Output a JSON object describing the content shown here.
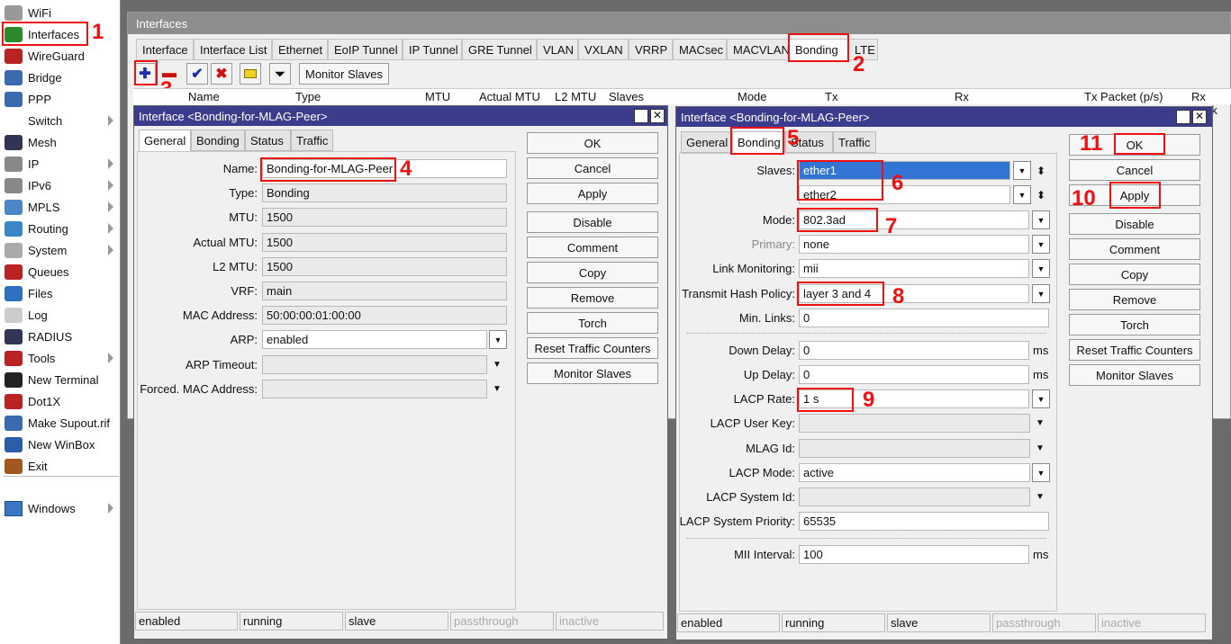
{
  "sidebar": {
    "items": [
      {
        "label": "WiFi",
        "icon": "wifi-icon"
      },
      {
        "label": "Interfaces",
        "icon": "interfaces-icon"
      },
      {
        "label": "WireGuard",
        "icon": "wireguard-icon"
      },
      {
        "label": "Bridge",
        "icon": "bridge-icon"
      },
      {
        "label": "PPP",
        "icon": "ppp-icon"
      },
      {
        "label": "Switch",
        "icon": "switch-icon"
      },
      {
        "label": "Mesh",
        "icon": "mesh-icon"
      },
      {
        "label": "IP",
        "icon": "ip-icon"
      },
      {
        "label": "IPv6",
        "icon": "ipv6-icon"
      },
      {
        "label": "MPLS",
        "icon": "mpls-icon"
      },
      {
        "label": "Routing",
        "icon": "routing-icon"
      },
      {
        "label": "System",
        "icon": "system-icon"
      },
      {
        "label": "Queues",
        "icon": "queues-icon"
      },
      {
        "label": "Files",
        "icon": "files-icon"
      },
      {
        "label": "Log",
        "icon": "log-icon"
      },
      {
        "label": "RADIUS",
        "icon": "radius-icon"
      },
      {
        "label": "Tools",
        "icon": "tools-icon"
      },
      {
        "label": "New Terminal",
        "icon": "terminal-icon"
      },
      {
        "label": "Dot1X",
        "icon": "dot1x-icon"
      },
      {
        "label": "Make Supout.rif",
        "icon": "supout-icon"
      },
      {
        "label": "New WinBox",
        "icon": "winbox-icon"
      },
      {
        "label": "Exit",
        "icon": "exit-icon"
      }
    ],
    "windows_label": "Windows"
  },
  "interfaces_window": {
    "title": "Interfaces",
    "tabs": [
      "Interface",
      "Interface List",
      "Ethernet",
      "EoIP Tunnel",
      "IP Tunnel",
      "GRE Tunnel",
      "VLAN",
      "VXLAN",
      "VRRP",
      "MACsec",
      "MACVLAN",
      "Bonding",
      "LTE"
    ],
    "monitor_slaves_label": "Monitor Slaves",
    "columns": [
      "Name",
      "Type",
      "MTU",
      "Actual MTU",
      "L2 MTU",
      "Slaves",
      "Mode",
      "Tx",
      "Rx",
      "Tx Packet (p/s)",
      "Rx Pack"
    ]
  },
  "dialog_left": {
    "title": "Interface <Bonding-for-MLAG-Peer>",
    "tabs": [
      "General",
      "Bonding",
      "Status",
      "Traffic"
    ],
    "fields": [
      {
        "label": "Name:",
        "value": "Bonding-for-MLAG-Peer"
      },
      {
        "label": "Type:",
        "value": "Bonding"
      },
      {
        "label": "MTU:",
        "value": "1500"
      },
      {
        "label": "Actual MTU:",
        "value": "1500"
      },
      {
        "label": "L2 MTU:",
        "value": "1500"
      },
      {
        "label": "VRF:",
        "value": "main"
      },
      {
        "label": "MAC Address:",
        "value": "50:00:00:01:00:00"
      },
      {
        "label": "ARP:",
        "value": "enabled"
      },
      {
        "label": "ARP Timeout:",
        "value": ""
      },
      {
        "label": "Forced. MAC Address:",
        "value": ""
      }
    ],
    "buttons": [
      "OK",
      "Cancel",
      "Apply",
      "Disable",
      "Comment",
      "Copy",
      "Remove",
      "Torch",
      "Reset Traffic Counters",
      "Monitor Slaves"
    ],
    "status": [
      "enabled",
      "running",
      "slave",
      "passthrough",
      "inactive"
    ]
  },
  "dialog_right": {
    "title": "Interface <Bonding-for-MLAG-Peer>",
    "tabs": [
      "General",
      "Bonding",
      "Status",
      "Traffic"
    ],
    "fields": [
      {
        "label": "Slaves:",
        "value": "ether1"
      },
      {
        "label": "",
        "value": "ether2"
      },
      {
        "label": "Mode:",
        "value": "802.3ad"
      },
      {
        "label": "Primary:",
        "value": "none"
      },
      {
        "label": "Link Monitoring:",
        "value": "mii"
      },
      {
        "label": "Transmit Hash Policy:",
        "value": "layer 3 and 4"
      },
      {
        "label": "Min. Links:",
        "value": "0"
      },
      {
        "label": "Down Delay:",
        "value": "0"
      },
      {
        "label": "Up Delay:",
        "value": "0"
      },
      {
        "label": "LACP Rate:",
        "value": "1 s"
      },
      {
        "label": "LACP User Key:",
        "value": ""
      },
      {
        "label": "MLAG Id:",
        "value": ""
      },
      {
        "label": "LACP Mode:",
        "value": "active"
      },
      {
        "label": "LACP System Id:",
        "value": ""
      },
      {
        "label": "LACP System Priority:",
        "value": "65535"
      },
      {
        "label": "MII Interval:",
        "value": "100"
      }
    ],
    "unit_ms": "ms",
    "buttons": [
      "OK",
      "Cancel",
      "Apply",
      "Disable",
      "Comment",
      "Copy",
      "Remove",
      "Torch",
      "Reset Traffic Counters",
      "Monitor Slaves"
    ],
    "status": [
      "enabled",
      "running",
      "slave",
      "passthrough",
      "inactive"
    ]
  },
  "annotations": [
    "1",
    "2",
    "3",
    "4",
    "5",
    "6",
    "7",
    "8",
    "9",
    "10",
    "11"
  ],
  "colors": {
    "title_bar": "#3c3c8c",
    "highlight": "#e11111",
    "selection": "#3375d4"
  }
}
